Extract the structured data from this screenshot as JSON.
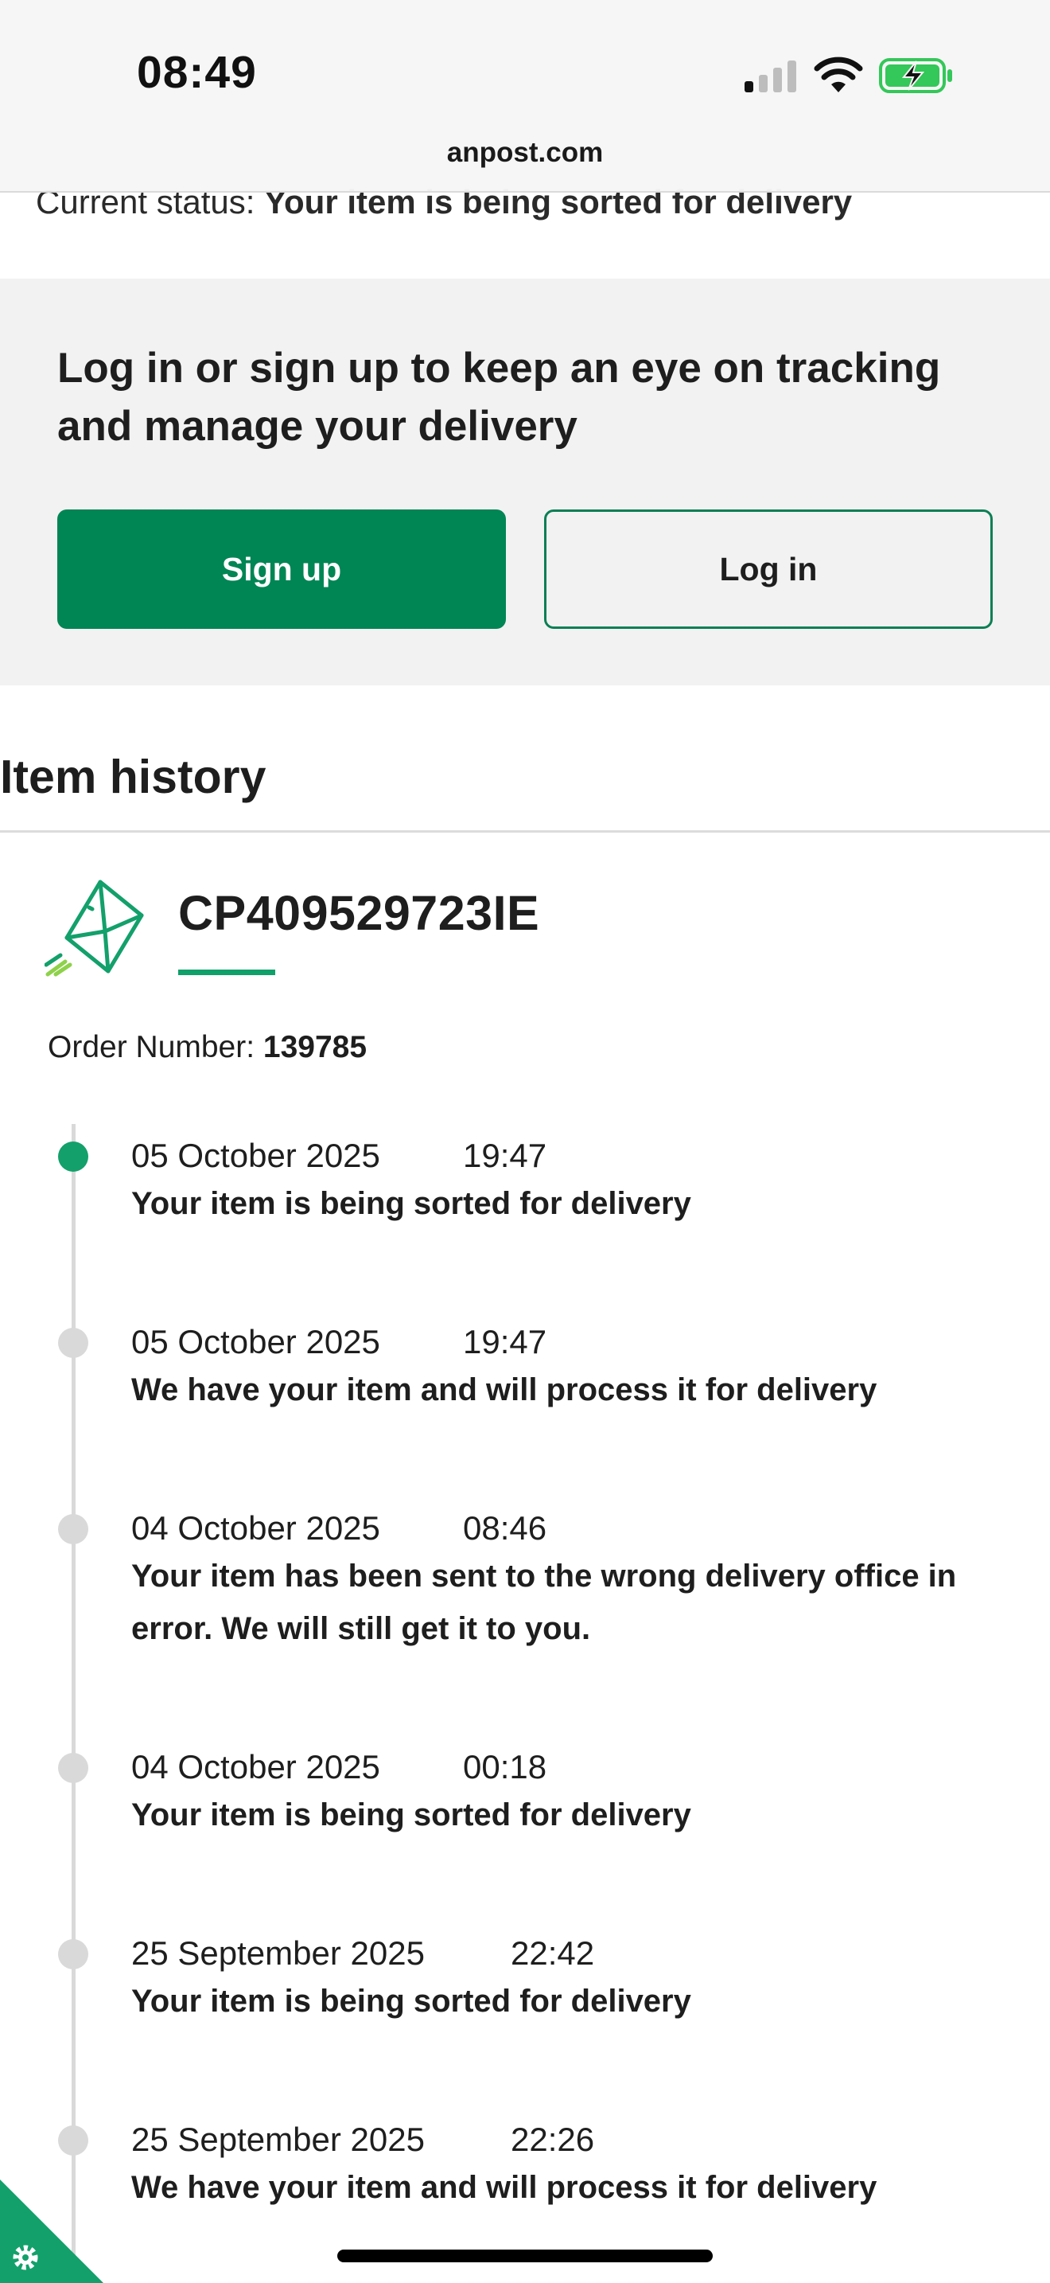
{
  "status_bar": {
    "time": "08:49",
    "icons": [
      "cellular-signal-icon",
      "wifi-icon",
      "battery-charging-icon"
    ],
    "battery_color": "#34c759"
  },
  "browser": {
    "url": "anpost.com"
  },
  "current_status": {
    "label": "Current status: ",
    "value": "Your item is being sorted for delivery"
  },
  "signup_panel": {
    "heading": "Log in or sign up to keep an eye on tracking and manage your delivery",
    "signup_label": "Sign up",
    "login_label": "Log in"
  },
  "history": {
    "title": "Item history",
    "tracking_number": "CP409529723IE",
    "order_label": "Order Number: ",
    "order_number": "139785",
    "events": [
      {
        "date": "05 October 2025",
        "time": "19:47",
        "description": "Your item is being sorted for delivery",
        "active": true
      },
      {
        "date": "05 October 2025",
        "time": "19:47",
        "description": "We have your item and will process it for delivery",
        "active": false
      },
      {
        "date": "04 October 2025",
        "time": "08:46",
        "description": "Your item has been sent to the wrong delivery office in error. We will still get it to you.",
        "active": false
      },
      {
        "date": "04 October 2025",
        "time": "00:18",
        "description": "Your item is being sorted for delivery",
        "active": false
      },
      {
        "date": "25 September 2025",
        "time": "22:42",
        "description": "Your item is being sorted for delivery",
        "active": false
      },
      {
        "date": "25 September 2025",
        "time": "22:26",
        "description": "We have your item and will process it for delivery",
        "active": false
      }
    ]
  },
  "colors": {
    "brand_green": "#008555",
    "accent_green": "#13a06b",
    "panel_bg": "#f2f2f2",
    "inactive_dot": "#d9d9d9"
  },
  "icons": {
    "parcel": "envelope-parcel-icon",
    "settings": "gear-icon"
  }
}
